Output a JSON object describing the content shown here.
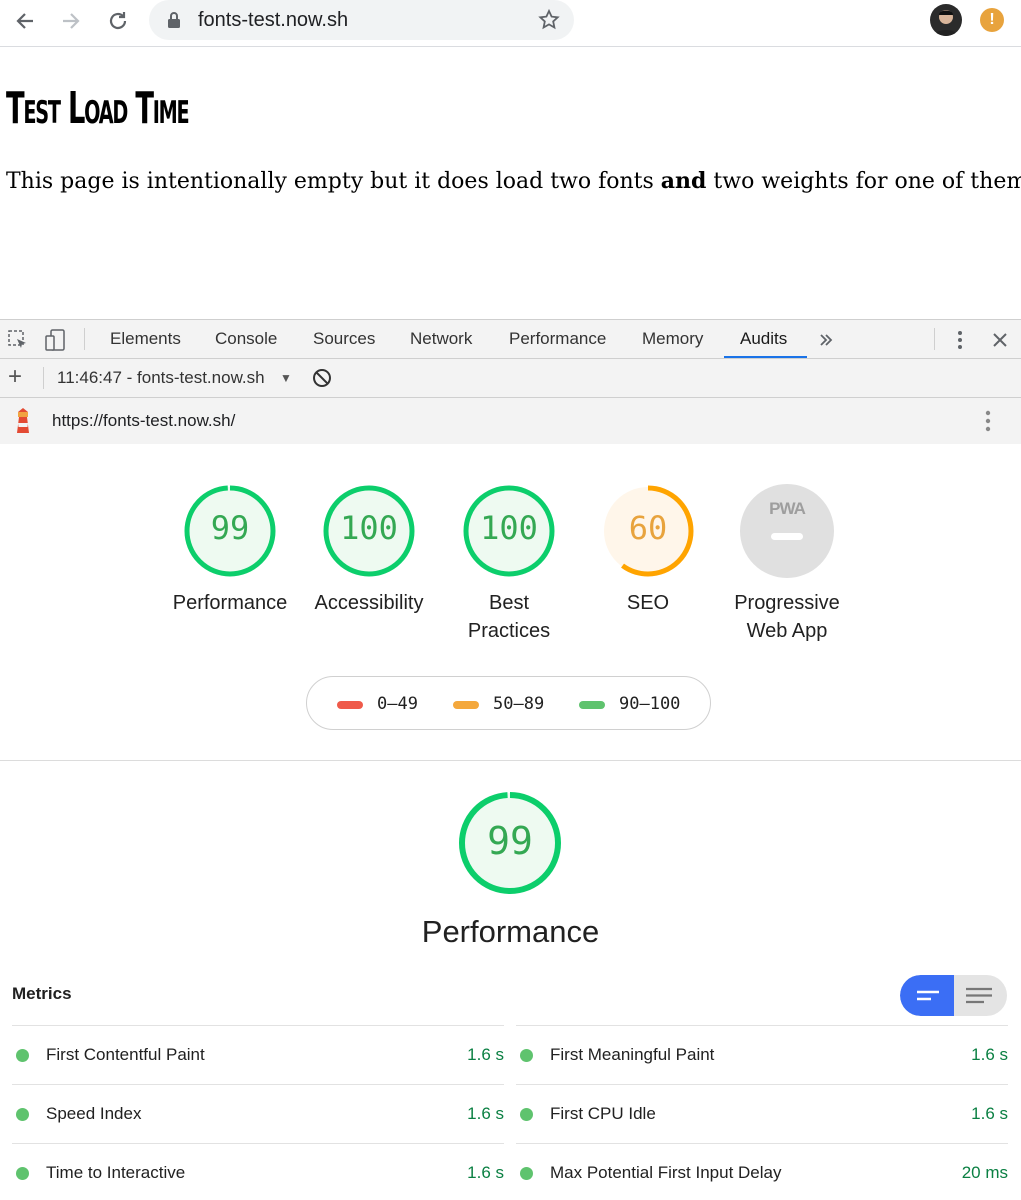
{
  "browser": {
    "url": "fonts-test.now.sh"
  },
  "page": {
    "title": "Test Load Time",
    "text_before": "This page is intentionally empty but it does load two fonts ",
    "text_bold": "and",
    "text_after": " two weights for one of them."
  },
  "devtools": {
    "tabs": [
      "Elements",
      "Console",
      "Sources",
      "Network",
      "Performance",
      "Memory",
      "Audits"
    ],
    "active_tab": "Audits",
    "run_label": "11:46:47 - fonts-test.now.sh",
    "audit_url": "https://fonts-test.now.sh/"
  },
  "categories": [
    {
      "score": "99",
      "label_line1": "Performance",
      "label_line2": "",
      "fraction": 0.99,
      "color": "#0cce6b"
    },
    {
      "score": "100",
      "label_line1": "Accessibility",
      "label_line2": "",
      "fraction": 1.0,
      "color": "#0cce6b"
    },
    {
      "score": "100",
      "label_line1": "Best",
      "label_line2": "Practices",
      "fraction": 1.0,
      "color": "#0cce6b"
    },
    {
      "score": "60",
      "label_line1": "SEO",
      "label_line2": "",
      "fraction": 0.6,
      "color": "#ffa400"
    },
    {
      "badge": "PWA",
      "label_line1": "Progressive",
      "label_line2": "Web App"
    }
  ],
  "legend": [
    {
      "range": "0–49",
      "color": "#ef5a4a"
    },
    {
      "range": "50–89",
      "color": "#f4a83c"
    },
    {
      "range": "90–100",
      "color": "#5fc36e"
    }
  ],
  "performance": {
    "score": "99",
    "fraction": 0.99,
    "title": "Performance",
    "metrics_heading": "Metrics",
    "metrics_left": [
      {
        "name": "First Contentful Paint",
        "value": "1.6 s"
      },
      {
        "name": "Speed Index",
        "value": "1.6 s"
      },
      {
        "name": "Time to Interactive",
        "value": "1.6 s"
      }
    ],
    "metrics_right": [
      {
        "name": "First Meaningful Paint",
        "value": "1.6 s"
      },
      {
        "name": "First CPU Idle",
        "value": "1.6 s"
      },
      {
        "name": "Max Potential First Input Delay",
        "value": "20 ms"
      }
    ]
  }
}
